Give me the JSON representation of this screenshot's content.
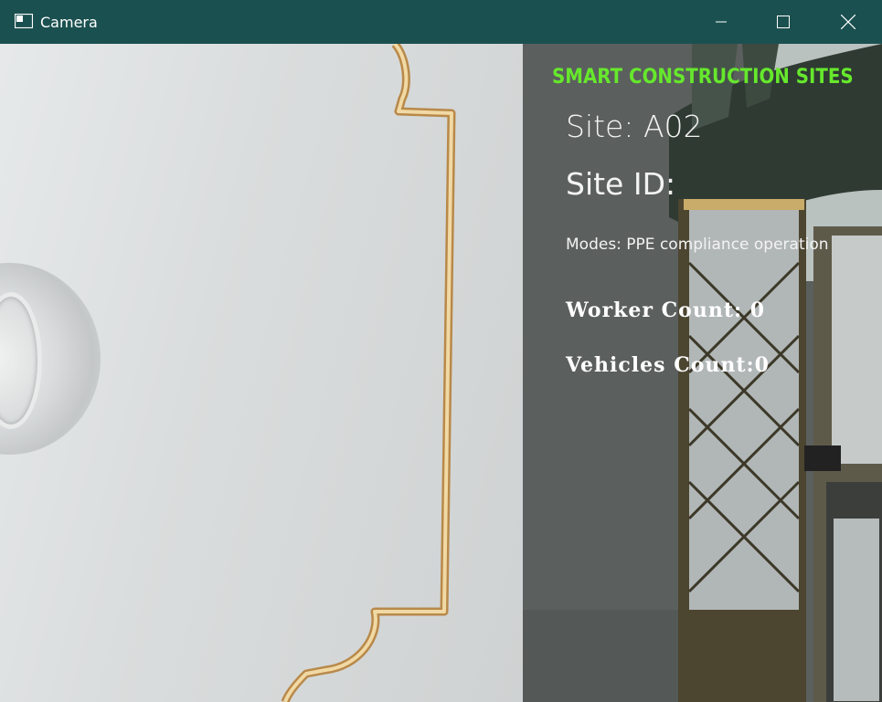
{
  "window": {
    "title": "Camera",
    "controls": {
      "minimize_icon": "minimize-icon",
      "maximize_icon": "maximize-icon",
      "close_icon": "close-icon"
    },
    "titlebar_color": "#1b5050"
  },
  "overlay": {
    "heading": "SMART CONSTRUCTION SITES",
    "site": "Site: A02",
    "site_id": "Site ID:",
    "modes": "Modes: PPE compliance operation",
    "worker_count": "Worker Count: 0",
    "vehicles_count": "Vehicles Count:0",
    "heading_color": "#66e82c",
    "text_color": "#ffffff"
  }
}
